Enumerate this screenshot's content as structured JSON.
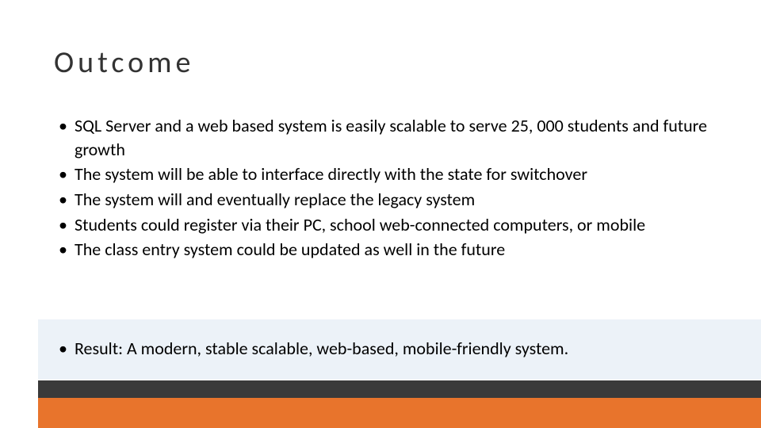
{
  "title": "Outcome",
  "bullets": [
    "SQL Server and a web based system is easily scalable to serve 25, 000 students and future growth",
    "The system will be able to interface directly with the state for switchover",
    "The system will and eventually replace the legacy system",
    "Students could register via their PC, school web-connected computers, or mobile",
    "The class entry system could be updated as well in the future"
  ],
  "result": "Result:  A modern, stable scalable, web-based, mobile-friendly system."
}
